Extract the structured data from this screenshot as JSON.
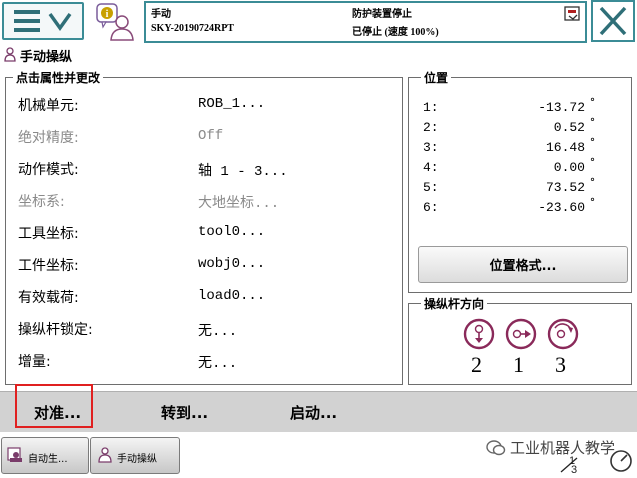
{
  "header": {
    "mode": "手动",
    "system_name": "SKY-20190724RPT",
    "safety_status": "防护装置停止",
    "run_status": "已停止 (速度 100%)"
  },
  "window_title": "手动操纵",
  "properties": {
    "legend": "点击属性并更改",
    "rows": [
      {
        "label": "机械单元:",
        "value": "ROB_1..."
      },
      {
        "label": "绝对精度:",
        "value": "Off"
      },
      {
        "label": "动作模式:",
        "value": "轴 1 - 3..."
      },
      {
        "label": "坐标系:",
        "value": "大地坐标..."
      },
      {
        "label": "工具坐标:",
        "value": "tool0..."
      },
      {
        "label": "工件坐标:",
        "value": "wobj0..."
      },
      {
        "label": "有效载荷:",
        "value": "load0..."
      },
      {
        "label": "操纵杆锁定:",
        "value": "无..."
      },
      {
        "label": "增量:",
        "value": "无..."
      }
    ]
  },
  "position": {
    "legend": "位置",
    "rows": [
      {
        "index": "1:",
        "value": "-13.72",
        "unit": "°"
      },
      {
        "index": "2:",
        "value": "0.52",
        "unit": "°"
      },
      {
        "index": "3:",
        "value": "16.48",
        "unit": "°"
      },
      {
        "index": "4:",
        "value": "0.00",
        "unit": "°"
      },
      {
        "index": "5:",
        "value": "73.52",
        "unit": "°"
      },
      {
        "index": "6:",
        "value": "-23.60",
        "unit": "°"
      }
    ],
    "format_button": "位置格式..."
  },
  "joystick": {
    "legend": "操纵杆方向",
    "axes": [
      {
        "number": "2",
        "icon": "joystick-vertical-icon"
      },
      {
        "number": "1",
        "icon": "joystick-horizontal-icon"
      },
      {
        "number": "3",
        "icon": "joystick-rotate-icon"
      }
    ]
  },
  "actions": {
    "align": "对准...",
    "goto": "转到...",
    "activate": "启动..."
  },
  "taskbar": {
    "tasks": [
      "自动生...",
      "手动操纵"
    ],
    "watermark": "工业机器人教学",
    "quickset_label": "1/3"
  },
  "colors": {
    "accent": "#3b8c96",
    "highlight": "#e02020",
    "action_bar": "#d2d2d2"
  }
}
